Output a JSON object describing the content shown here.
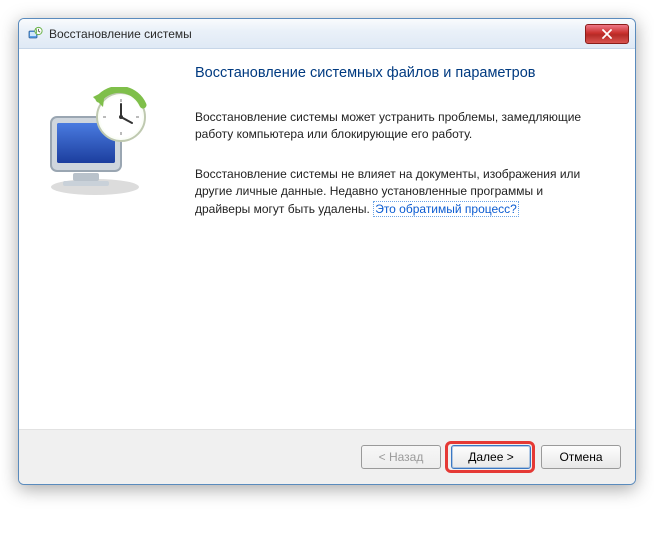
{
  "window": {
    "title": "Восстановление системы"
  },
  "content": {
    "heading": "Восстановление системных файлов и параметров",
    "paragraph1": "Восстановление системы может устранить проблемы, замедляющие работу компьютера или блокирующие его работу.",
    "paragraph2_prefix": "Восстановление системы не влияет на документы, изображения или другие личные данные. Недавно установленные программы и драйверы могут быть удалены. ",
    "paragraph2_link": "Это обратимый процесс?"
  },
  "buttons": {
    "back": "< Назад",
    "next": "Далее >",
    "cancel": "Отмена"
  },
  "icons": {
    "app": "system-restore-icon",
    "close": "close-icon"
  }
}
